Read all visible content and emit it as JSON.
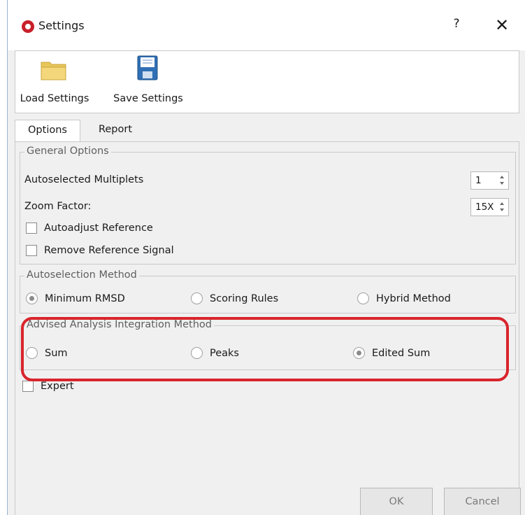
{
  "window": {
    "title": "Settings",
    "help": "?",
    "close": "✕"
  },
  "toolbar": {
    "load_label": "Load Settings",
    "save_label": "Save Settings"
  },
  "tabs": [
    {
      "label": "Options"
    },
    {
      "label": "Report"
    }
  ],
  "general": {
    "legend": "General Options",
    "multiplets_label": "Autoselected Multiplets",
    "multiplets_value": "1",
    "zoom_label": "Zoom Factor:",
    "zoom_value": "15X",
    "autoadjust_label": "Autoadjust Reference",
    "remove_label": "Remove Reference Signal"
  },
  "autoselection": {
    "legend": "Autoselection Method",
    "options": [
      {
        "label": "Minimum RMSD",
        "selected": true
      },
      {
        "label": "Scoring Rules",
        "selected": false
      },
      {
        "label": "Hybrid Method",
        "selected": false
      }
    ]
  },
  "integration": {
    "legend": "Advised Analysis Integration Method",
    "options": [
      {
        "label": "Sum",
        "selected": false
      },
      {
        "label": "Peaks",
        "selected": false
      },
      {
        "label": "Edited Sum",
        "selected": true
      }
    ]
  },
  "expert_label": "Expert",
  "buttons": {
    "ok": "OK",
    "cancel": "Cancel"
  },
  "colors": {
    "highlight": "#d9242c",
    "app_icon": "#c8202a"
  }
}
